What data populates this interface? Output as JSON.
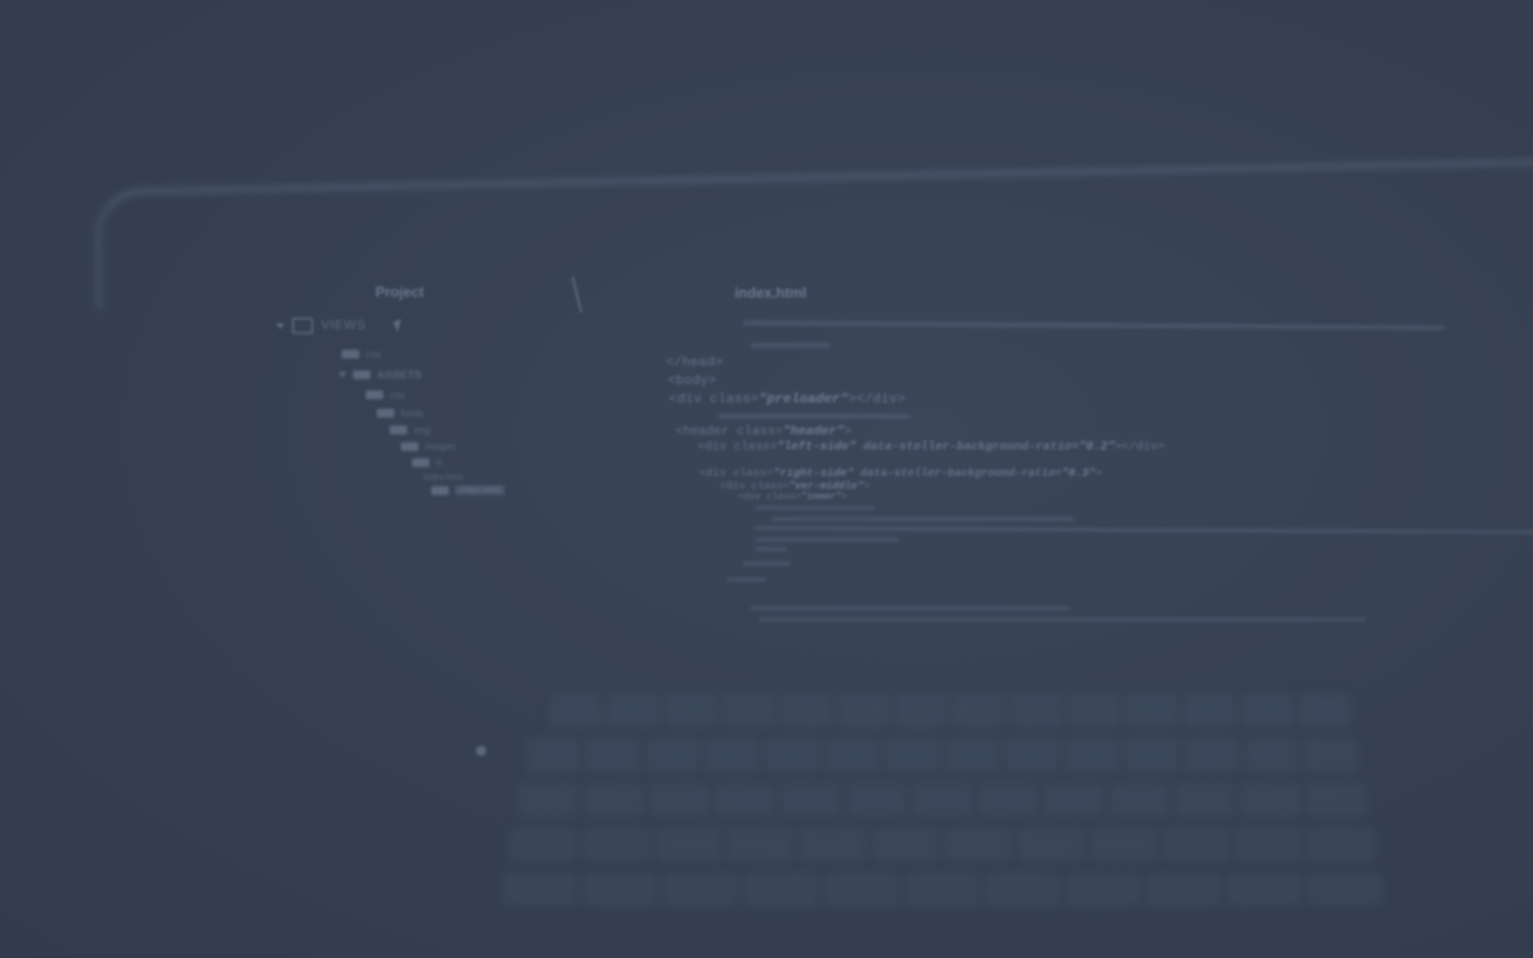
{
  "sidebar": {
    "title": "Project",
    "root_label": "VIEWS",
    "tree": [
      {
        "label": "css"
      },
      {
        "label": "ASSETS"
      },
      {
        "label": "css"
      },
      {
        "label": "fonts"
      },
      {
        "label": "img"
      },
      {
        "label": "images"
      },
      {
        "label": "js"
      },
      {
        "label": "index.html"
      },
      {
        "label": "index.html"
      }
    ]
  },
  "editor": {
    "tab_title": "index.html",
    "lines": {
      "l1": "</head>",
      "l2": "<body>",
      "l3a": "<div class=",
      "l3b": "\"preloader\"",
      "l3c": "></div>",
      "l4a": "<header class=",
      "l4b": "\"header\"",
      "l4c": ">",
      "l5a": "<div class=",
      "l5b": "\"left-side\"",
      "l5c": " data-steller-background-ratio=",
      "l5d": "\"0.2\"",
      "l5e": "></div>",
      "l6a": "<div class=",
      "l6b": "\"right-side\"",
      "l6c": " data-steller-background-ratio=",
      "l6d": "\"0.3\"",
      "l6e": ">",
      "l7a": "<div class=",
      "l7b": "\"ver-middle\"",
      "l7c": ">",
      "l8a": "<div class=",
      "l8b": "\"inner\"",
      "l8c": ">"
    }
  },
  "colors": {
    "background": "#353f51"
  }
}
